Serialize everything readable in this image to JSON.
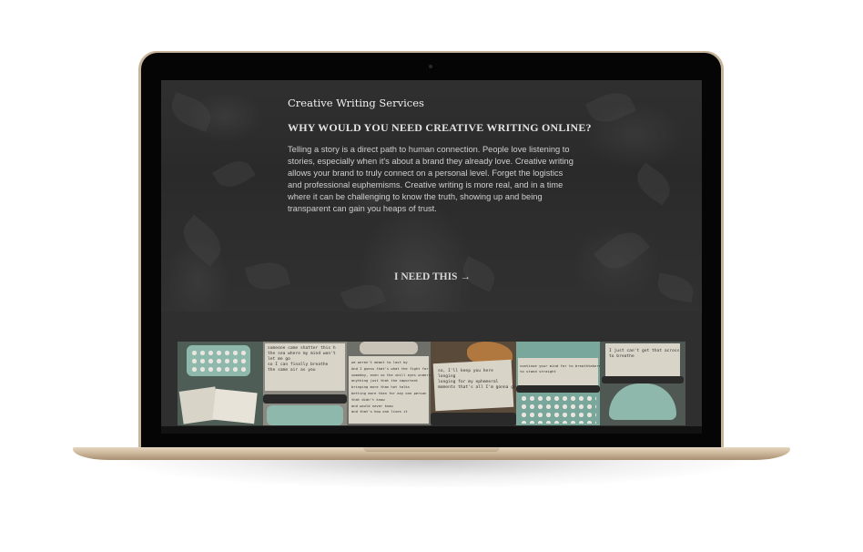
{
  "hero": {
    "service_label": "Creative Writing Services",
    "heading": "WHY WOULD YOU NEED CREATIVE WRITING ONLINE?",
    "body": "Telling a story is a direct path to human connection. People love listening to stories, especially when it's about a brand they already love. Creative writing allows your brand to truly connect on a personal level. Forget the logistics and professional euphemisms. Creative writing is more real, and in a time where it can be challenging to know the truth, showing up and being transparent can gain you heaps of trust.",
    "cta_label": "I NEED THIS →"
  },
  "gallery": {
    "tiles": [
      {
        "name": "typewriter-photo-1",
        "text": ""
      },
      {
        "name": "typewriter-photo-2",
        "text": "someone came shatter this h\nthe sea where my mind won't\nlet me go\nso I can finally breathe\nthe same air as you"
      },
      {
        "name": "typewriter-photo-3",
        "text": "we weren't meant to last by\nAnd I guess that's what the fight for me more\nsomeday, even so the skill eyes underneath\nanything just that the important\nbringing more than hot talks\nbetting more than for any one person\nthat didn't know\nand would never know\nand that's how one lives it"
      },
      {
        "name": "typewriter-photo-4",
        "text": "so, I'll keep you here\nlonging\nlonging for my ephemeral\nmoments that's all I'm gonna get"
      },
      {
        "name": "typewriter-photo-5",
        "text": "continue your mind for to breathtakers after\nto stand straight"
      },
      {
        "name": "typewriter-photo-6",
        "text": "I just can't get that across\nto breathe"
      }
    ]
  },
  "colors": {
    "frame_gold": "#c8b49a",
    "screen_bg": "#2b2b2b",
    "typewriter_mint": "#8fb8ad"
  }
}
